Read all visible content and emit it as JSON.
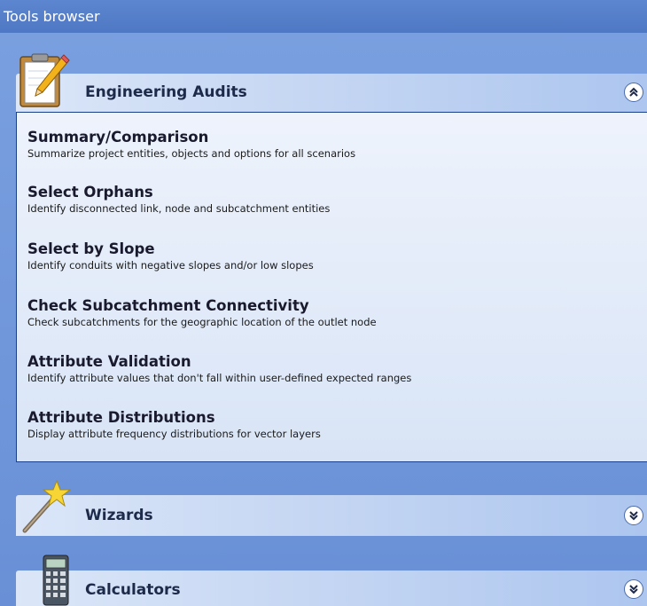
{
  "window": {
    "title": "Tools browser"
  },
  "panels": [
    {
      "title": "Engineering Audits",
      "icon": "clipboard-pencil-icon",
      "state": "expanded",
      "tools": [
        {
          "title": "Summary/Comparison",
          "description": "Summarize project entities, objects and options for all scenarios"
        },
        {
          "title": "Select Orphans",
          "description": "Identify disconnected link, node and subcatchment entities"
        },
        {
          "title": "Select by Slope",
          "description": "Identify conduits with negative slopes and/or low slopes"
        },
        {
          "title": "Check Subcatchment Connectivity",
          "description": "Check subcatchments for the geographic location of the outlet node"
        },
        {
          "title": "Attribute Validation",
          "description": "Identify attribute values that don't fall within user-defined expected ranges"
        },
        {
          "title": "Attribute Distributions",
          "description": "Display attribute frequency distributions for vector layers"
        }
      ]
    },
    {
      "title": "Wizards",
      "icon": "magic-wand-icon",
      "state": "collapsed"
    },
    {
      "title": "Calculators",
      "icon": "calculator-icon",
      "state": "collapsed"
    }
  ],
  "colors": {
    "background": "#6f95d8",
    "title_bar": "#5680cc",
    "panel_header": "#c6d7f3",
    "panel_body": "#e3ebf9",
    "panel_border": "#1c3f8a"
  }
}
